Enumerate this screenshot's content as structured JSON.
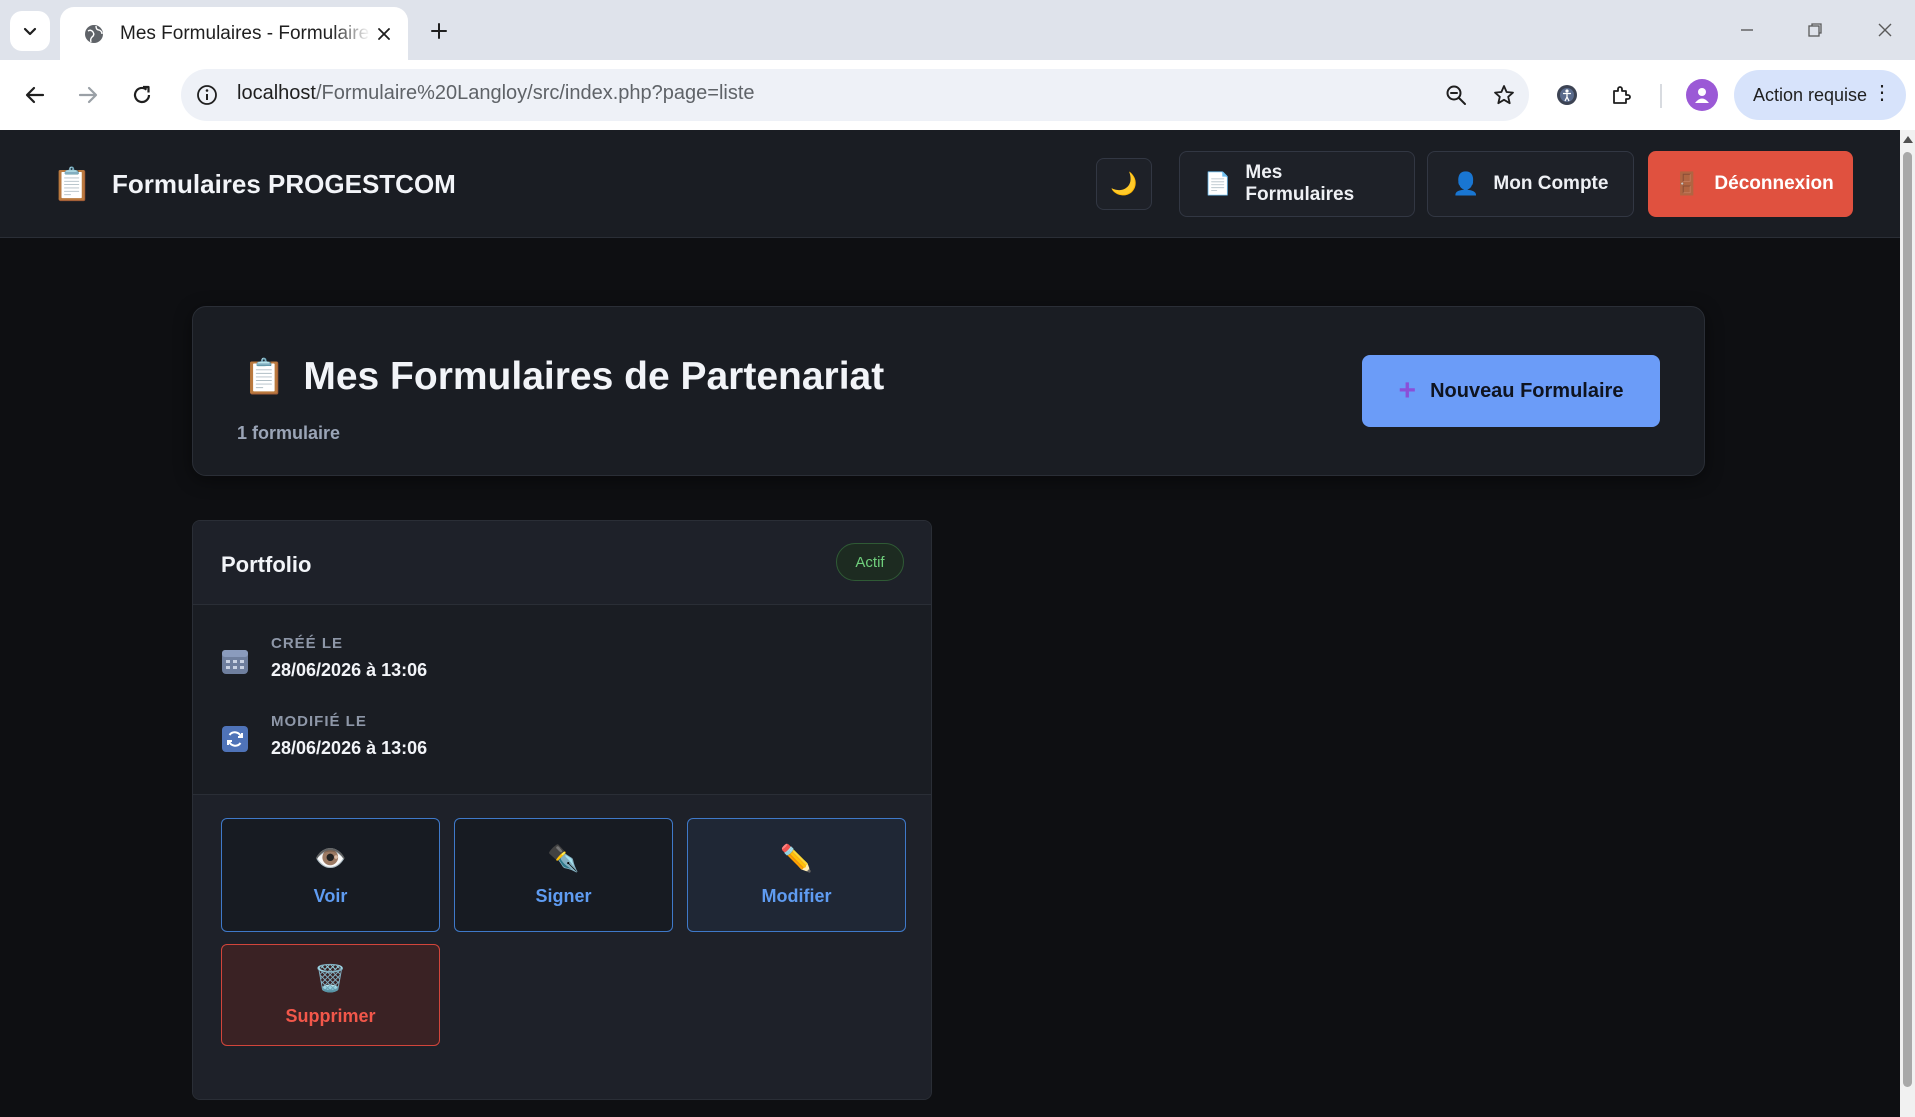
{
  "browser": {
    "tab_title": "Mes Formulaires - Formulaires PROGESTCOM",
    "url_host": "localhost",
    "url_path": "/Formulaire%20Langloy/src/index.php?page=liste",
    "action_label": "Action requise"
  },
  "header": {
    "brand_emoji": "📋",
    "brand_name": "Formulaires PROGESTCOM",
    "theme_icon": "🌙",
    "nav": [
      {
        "icon": "📄",
        "label": "Mes Formulaires"
      },
      {
        "icon": "👤",
        "label": "Mon Compte"
      },
      {
        "icon": "🚪",
        "label": "Déconnexion"
      }
    ]
  },
  "hero": {
    "emoji": "📋",
    "title": "Mes Formulaires de Partenariat",
    "count": "1 formulaire",
    "new_button_icon": "➕",
    "new_button_label": "Nouveau Formulaire"
  },
  "card": {
    "title": "Portfolio",
    "status": "Actif",
    "created_label": "CRÉÉ LE",
    "created_value": "28/06/2026 à 13:06",
    "modified_label": "MODIFIÉ LE",
    "modified_value": "28/06/2026 à 13:06",
    "actions": [
      {
        "icon": "👁️",
        "label": "Voir"
      },
      {
        "icon": "✒️",
        "label": "Signer"
      },
      {
        "icon": "✏️",
        "label": "Modifier"
      },
      {
        "icon": "🗑️",
        "label": "Supprimer"
      }
    ]
  },
  "colors": {
    "accent": "#6b9cf8",
    "danger": "#e0513f",
    "success": "#6fcf7c",
    "background": "#0e0f12",
    "surface": "#1a1d23"
  }
}
